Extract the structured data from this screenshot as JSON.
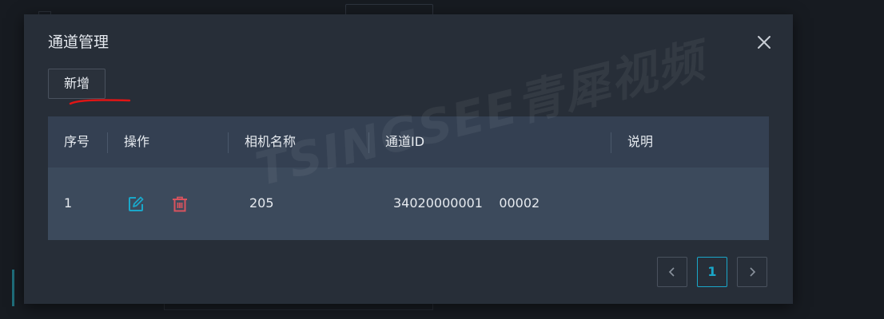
{
  "dialog": {
    "title": "通道管理",
    "close_icon": "close-icon"
  },
  "toolbar": {
    "add_label": "新增"
  },
  "table": {
    "columns": [
      "序号",
      "操作",
      "相机名称",
      "通道ID",
      "说明"
    ],
    "rows": [
      {
        "index": "1",
        "camera_name": "205",
        "channel_id": "34020000001    00002",
        "description": ""
      }
    ]
  },
  "watermark": {
    "text": "TSINGSEE青犀视频"
  },
  "pagination": {
    "current_page": "1"
  },
  "colors": {
    "accent": "#1aa7c9",
    "danger": "#d9535e",
    "annotation": "#e01515"
  },
  "icons": {
    "edit": "edit-icon",
    "delete": "trash-icon",
    "prev": "chevron-left-icon",
    "next": "chevron-right-icon"
  }
}
